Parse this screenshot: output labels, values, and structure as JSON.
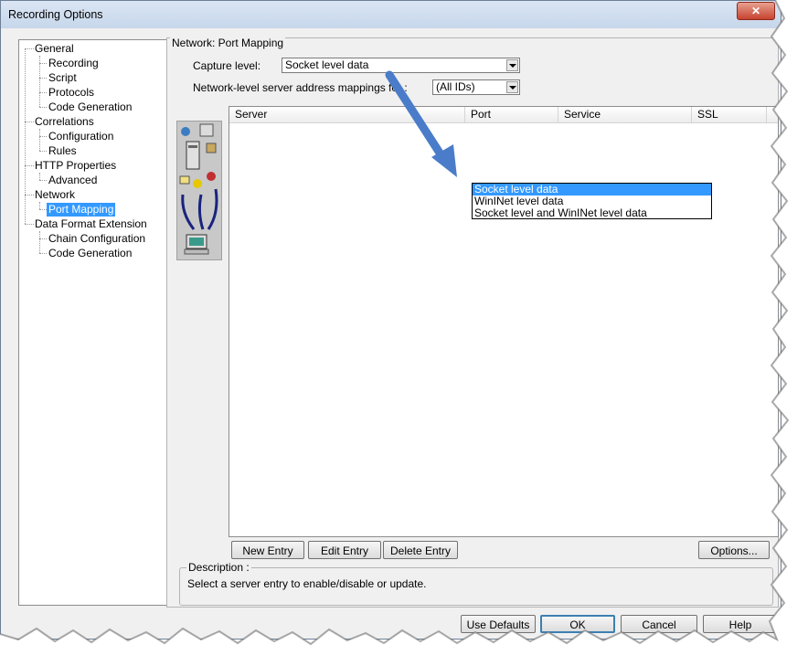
{
  "window": {
    "title": "Recording Options",
    "close_glyph": "✕"
  },
  "tree": {
    "items": [
      {
        "label": "General"
      },
      {
        "label": "Recording"
      },
      {
        "label": "Script"
      },
      {
        "label": "Protocols"
      },
      {
        "label": "Code Generation"
      },
      {
        "label": "Correlations"
      },
      {
        "label": "Configuration"
      },
      {
        "label": "Rules"
      },
      {
        "label": "HTTP Properties"
      },
      {
        "label": "Advanced"
      },
      {
        "label": "Network"
      },
      {
        "label": "Port Mapping",
        "selected": true
      },
      {
        "label": "Data Format Extension"
      },
      {
        "label": "Chain Configuration"
      },
      {
        "label": "Code Generation"
      }
    ]
  },
  "panel": {
    "title": "Network: Port Mapping",
    "capture_label": "Capture level:",
    "capture_value": "Socket level data",
    "mapping_label": "Network-level server address mappings for :",
    "mapping_value": "(All IDs)"
  },
  "list": {
    "columns": [
      "Server",
      "Port",
      "Service",
      "SSL"
    ]
  },
  "dropdown": {
    "options": [
      "Socket level data",
      "WinINet level data",
      "Socket level and WinINet level data"
    ],
    "selected_index": 0
  },
  "buttons": {
    "new_entry": "New Entry",
    "edit_entry": "Edit Entry",
    "delete_entry": "Delete Entry",
    "options": "Options...",
    "use_defaults": "Use Defaults",
    "ok": "OK",
    "cancel": "Cancel",
    "help": "Help"
  },
  "description": {
    "title": "Description :",
    "text": "Select a server entry to enable/disable or update."
  },
  "colors": {
    "selection": "#3399ff",
    "annotation_arrow": "#4a7cc9"
  },
  "icons": [
    "globe-computer-icon",
    "server-tower-icon",
    "network-links-icon",
    "workstation-icon"
  ]
}
